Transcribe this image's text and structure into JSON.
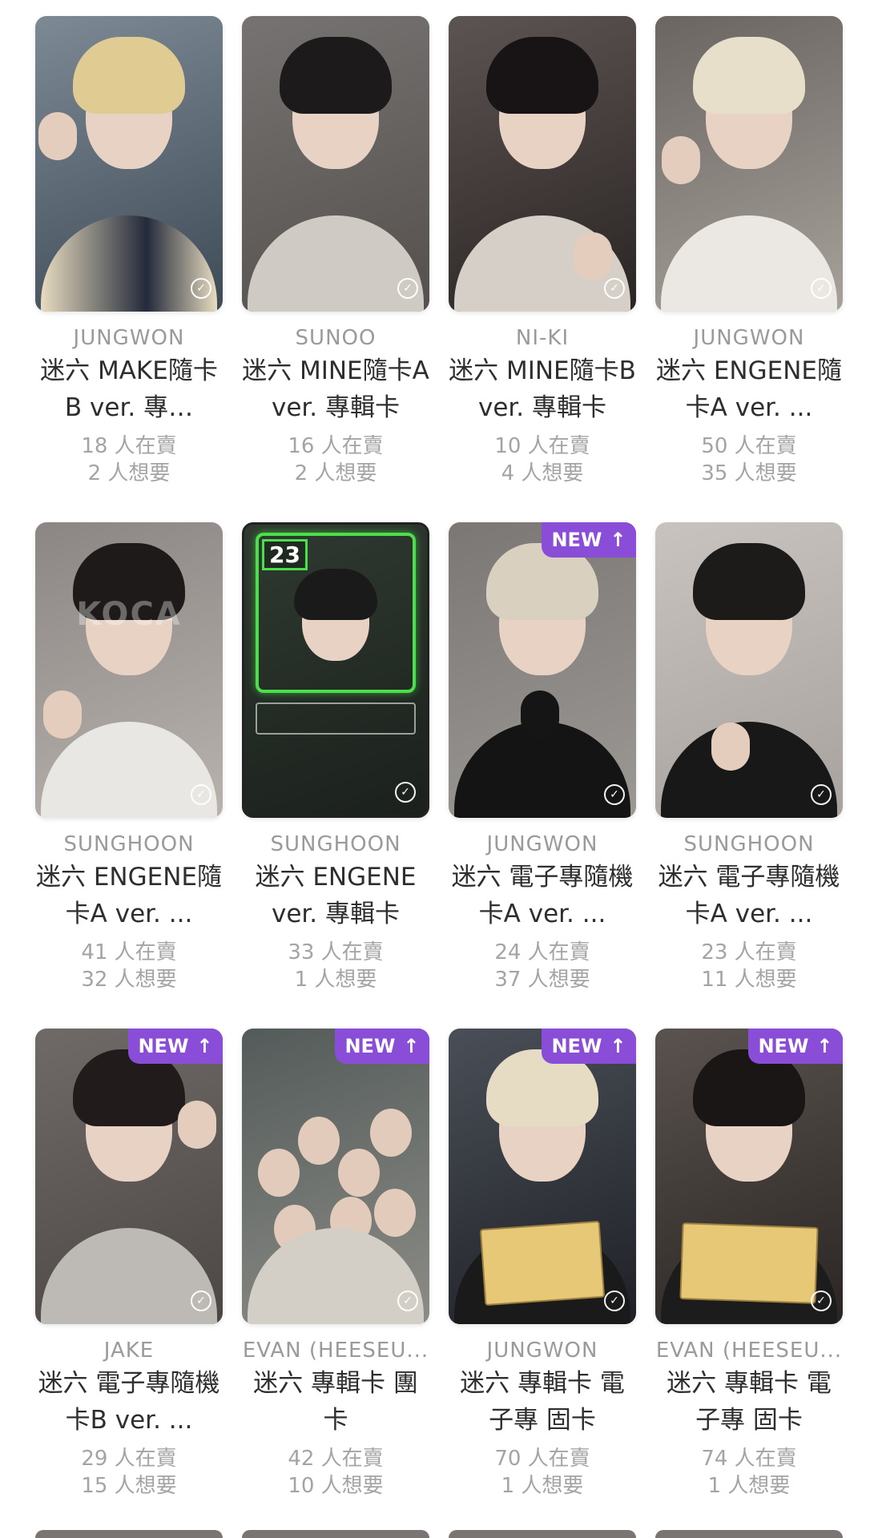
{
  "cards": [
    {
      "member": "JUNGWON",
      "title": "迷六 MAKE隨卡B ver. 專…",
      "selling": "18 人在賣",
      "wanting": "2 人想要",
      "is_new": false
    },
    {
      "member": "SUNOO",
      "title": "迷六 MINE隨卡A ver. 專輯卡",
      "selling": "16 人在賣",
      "wanting": "2 人想要",
      "is_new": false
    },
    {
      "member": "NI-KI",
      "title": "迷六 MINE隨卡B ver. 專輯卡",
      "selling": "10 人在賣",
      "wanting": "4 人想要",
      "is_new": false
    },
    {
      "member": "JUNGWON",
      "title": "迷六 ENGENE隨卡A ver. ...",
      "selling": "50 人在賣",
      "wanting": "35 人想要",
      "is_new": false
    },
    {
      "member": "SUNGHOON",
      "title": "迷六 ENGENE隨卡A ver. ...",
      "selling": "41 人在賣",
      "wanting": "32 人想要",
      "is_new": false
    },
    {
      "member": "SUNGHOON",
      "title": "迷六 ENGENE ver. 專輯卡",
      "selling": "33 人在賣",
      "wanting": "1 人想要",
      "is_new": false
    },
    {
      "member": "JUNGWON",
      "title": "迷六 電子專隨機卡A ver. ...",
      "selling": "24 人在賣",
      "wanting": "37 人想要",
      "is_new": true
    },
    {
      "member": "SUNGHOON",
      "title": "迷六 電子專隨機卡A ver. ...",
      "selling": "23 人在賣",
      "wanting": "11 人想要",
      "is_new": false
    },
    {
      "member": "JAKE",
      "title": "迷六 電子專隨機卡B ver. ...",
      "selling": "29 人在賣",
      "wanting": "15 人想要",
      "is_new": true
    },
    {
      "member": "EVAN (HEESEU...",
      "title": "迷六 專輯卡 團卡",
      "selling": "42 人在賣",
      "wanting": "10 人想要",
      "is_new": true
    },
    {
      "member": "JUNGWON",
      "title": "迷六 專輯卡 電子專 固卡",
      "selling": "70 人在賣",
      "wanting": "1 人想要",
      "is_new": true
    },
    {
      "member": "EVAN (HEESEU...",
      "title": "迷六 專輯卡 電子專 固卡",
      "selling": "74 人在賣",
      "wanting": "1 人想要",
      "is_new": true
    }
  ],
  "badge": {
    "label": "NEW",
    "arrow": "↑"
  },
  "watermark": "KOCA",
  "game_card": {
    "number": "23"
  },
  "colors": {
    "badge_bg": "#8a4dd8",
    "member_text": "#9a9a9a",
    "title_text": "#2e2e2e",
    "stat_text": "#a4a4a4"
  },
  "icons": {
    "check": "check-circle-icon",
    "arrow": "arrow-up-icon"
  }
}
